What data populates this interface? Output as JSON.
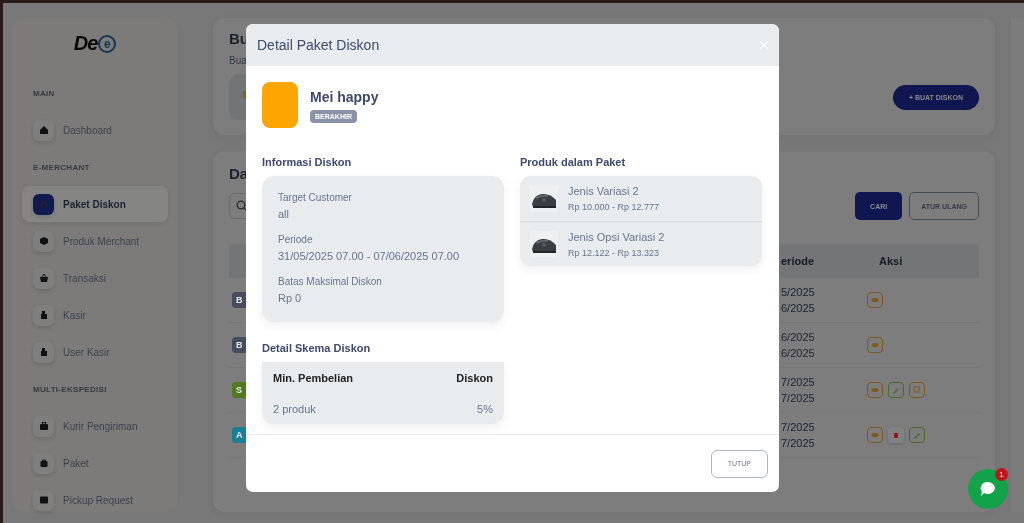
{
  "sidebar": {
    "logo": {
      "text": "De",
      "mark": "e"
    },
    "sections": [
      {
        "title": "MAIN",
        "items": [
          {
            "label": "Dashboard",
            "selected": false
          }
        ]
      },
      {
        "title": "E-MERCHANT",
        "items": [
          {
            "label": "Paket Diskon",
            "selected": true
          },
          {
            "label": "Produk Merchant",
            "selected": false
          },
          {
            "label": "Transaksi",
            "selected": false
          },
          {
            "label": "Kasir",
            "selected": false
          },
          {
            "label": "User Kasir",
            "selected": false
          }
        ]
      },
      {
        "title": "MULTI-EKSPEDISI",
        "items": [
          {
            "label": "Kurir Pengiriman",
            "selected": false
          },
          {
            "label": "Paket",
            "selected": false
          },
          {
            "label": "Pickup Request",
            "selected": false
          }
        ]
      }
    ]
  },
  "header_card": {
    "title": "Bu",
    "subtitle": "Bua",
    "button": "+ BUAT DISKON"
  },
  "list_card": {
    "title": "Da",
    "search_button": "CARI",
    "reset_button": "ATUR ULANG",
    "columns": [
      "eriode",
      "Aksi"
    ],
    "rows": [
      {
        "status": "B",
        "color": "#454d5e",
        "period": [
          "5/2025",
          "6/2025"
        ],
        "actions": [
          {
            "kind": "view"
          }
        ]
      },
      {
        "status": "B",
        "color": "#454d5e",
        "period": [
          "6/2025",
          "6/2025"
        ],
        "actions": [
          {
            "kind": "view"
          }
        ]
      },
      {
        "status": "S",
        "color": "#4f7a1e",
        "period": [
          "7/2025",
          "7/2025"
        ],
        "actions": [
          {
            "kind": "view"
          },
          {
            "kind": "edit"
          },
          {
            "kind": "copy"
          }
        ]
      },
      {
        "status": "A",
        "color": "#1a7f96",
        "period": [
          "7/2025",
          "7/2025"
        ],
        "actions": [
          {
            "kind": "view"
          },
          {
            "kind": "delete"
          },
          {
            "kind": "edit"
          }
        ]
      }
    ]
  },
  "modal": {
    "title": "Detail Paket Diskon",
    "package": {
      "name": "Mei happy",
      "status": "BERAKHIR"
    },
    "info": {
      "heading": "Informasi Diskon",
      "fields": [
        {
          "label": "Target Customer",
          "value": "all"
        },
        {
          "label": "Periode",
          "value": "31/05/2025 07.00 - 07/06/2025 07.00"
        },
        {
          "label": "Batas Maksimal Diskon",
          "value": "Rp 0"
        }
      ]
    },
    "scheme": {
      "heading": "Detail Skema Diskon",
      "columns": [
        "Min. Pembelian",
        "Diskon"
      ],
      "rows": [
        [
          "2 produk",
          "5%"
        ]
      ]
    },
    "products": {
      "heading": "Produk dalam Paket",
      "items": [
        {
          "name": "Jenis Variasi 2",
          "price": "Rp 10.000 - Rp 12.777"
        },
        {
          "name": "Jenis Opsi Variasi 2",
          "price": "Rp 12.122 - Rp 13.323"
        }
      ]
    },
    "close_button": "TUTUP"
  },
  "chat": {
    "badge": "1"
  }
}
